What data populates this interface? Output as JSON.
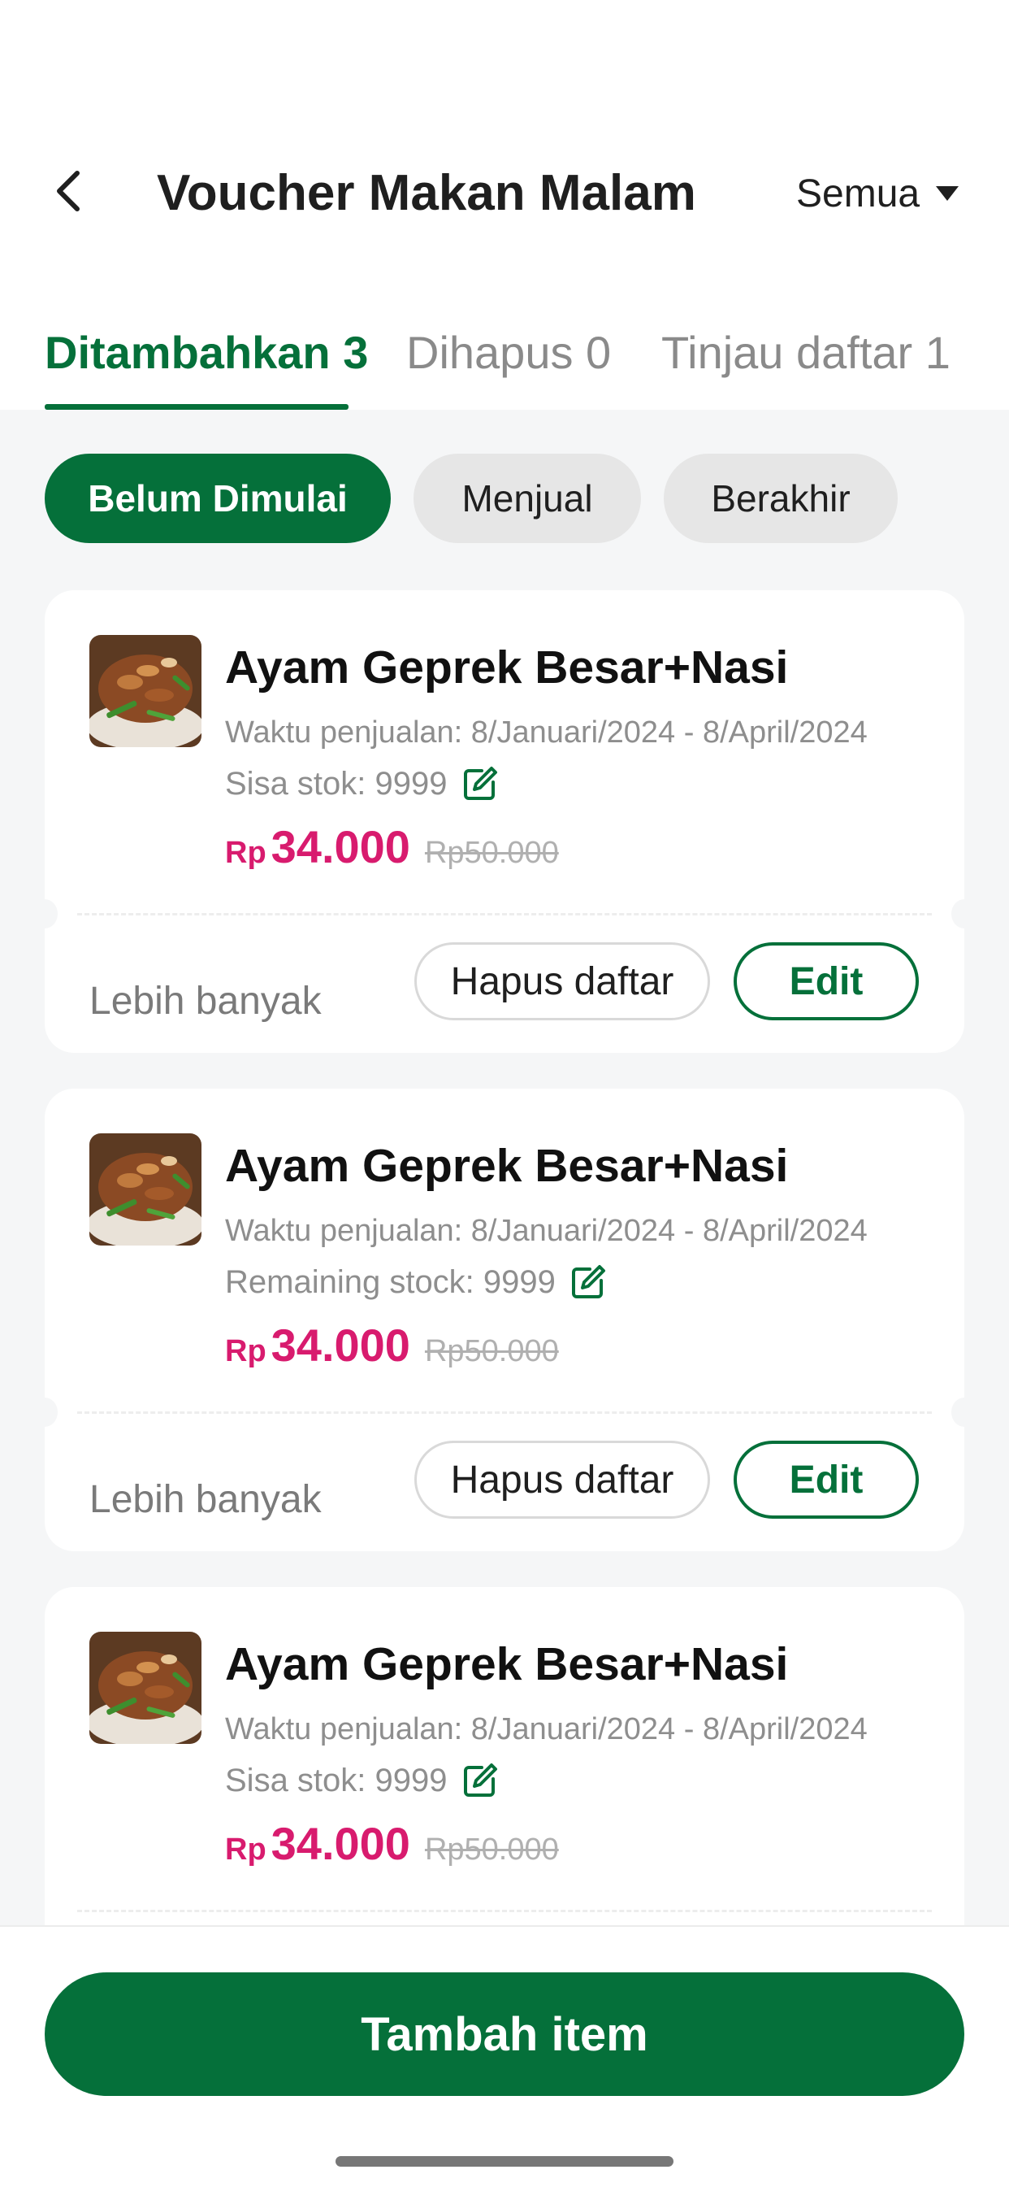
{
  "header": {
    "title": "Voucher Makan Malam",
    "filter_label": "Semua"
  },
  "tabs": [
    {
      "label": "Ditambahkan 3",
      "active": true
    },
    {
      "label": "Dihapus 0",
      "active": false
    },
    {
      "label": "Tinjau daftar 1",
      "active": false
    }
  ],
  "chips": [
    {
      "label": "Belum Dimulai",
      "active": true
    },
    {
      "label": "Menjual",
      "active": false
    },
    {
      "label": "Berakhir",
      "active": false
    }
  ],
  "items": [
    {
      "title": "Ayam Geprek Besar+Nasi",
      "sale_time": "Waktu penjualan: 8/Januari/2024 - 8/April/2024",
      "stock": "Sisa stok: 9999",
      "currency": "Rp",
      "price": "34.000",
      "original_price": "Rp50.000",
      "more_label": "Lebih banyak",
      "delete_label": "Hapus daftar",
      "edit_label": "Edit"
    },
    {
      "title": "Ayam Geprek Besar+Nasi",
      "sale_time": "Waktu penjualan: 8/Januari/2024 - 8/April/2024",
      "stock": "Remaining stock: 9999",
      "currency": "Rp",
      "price": "34.000",
      "original_price": "Rp50.000",
      "more_label": "Lebih banyak",
      "delete_label": "Hapus daftar",
      "edit_label": "Edit"
    },
    {
      "title": "Ayam Geprek Besar+Nasi",
      "sale_time": "Waktu penjualan: 8/Januari/2024 - 8/April/2024",
      "stock": "Sisa stok: 9999",
      "currency": "Rp",
      "price": "34.000",
      "original_price": "Rp50.000"
    }
  ],
  "footer": {
    "add_button_label": "Tambah item"
  },
  "colors": {
    "brand_green": "#05703A",
    "price_pink": "#D81B6E",
    "background": "#F5F6F7"
  },
  "icons": {
    "back": "chevron-left-icon",
    "dropdown": "caret-down-icon",
    "edit_stock": "edit-pencil-icon",
    "thumbnail": "food-photo"
  }
}
